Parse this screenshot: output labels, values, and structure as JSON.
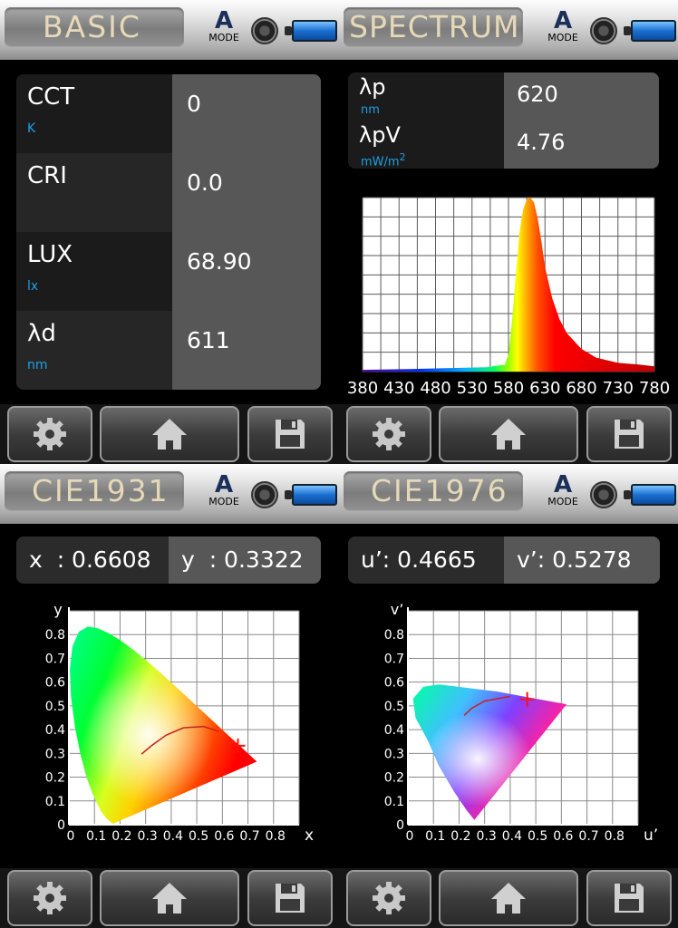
{
  "header": {
    "mode_letter": "A",
    "mode_label": "MODE"
  },
  "footer": {
    "settings_icon": "gear-icon",
    "home_icon": "home-icon",
    "save_icon": "floppy-disk-icon"
  },
  "panels": {
    "basic": {
      "title": "BASIC",
      "rows": [
        {
          "name": "CCT",
          "unit": "K",
          "value": "0"
        },
        {
          "name": "CRI",
          "unit": "",
          "value": "0.0"
        },
        {
          "name": "LUX",
          "unit": "lx",
          "value": "68.90"
        },
        {
          "name": "λd",
          "unit": "nm",
          "value": "611"
        }
      ]
    },
    "spectrum": {
      "title": "SPECTRUM",
      "rows": [
        {
          "name": "λp",
          "unit": "nm",
          "value": "620"
        },
        {
          "name": "λpV",
          "unit": "mW/m",
          "unit_sup": "2",
          "value": "4.76"
        }
      ],
      "chart_data": {
        "type": "area",
        "x": [
          380,
          450,
          500,
          550,
          575,
          580,
          585,
          590,
          595,
          600,
          605,
          610,
          615,
          620,
          625,
          630,
          640,
          650,
          660,
          680,
          700,
          730,
          760,
          780
        ],
        "y": [
          0.01,
          0.015,
          0.02,
          0.025,
          0.04,
          0.1,
          0.3,
          0.55,
          0.8,
          0.93,
          0.99,
          1.0,
          0.97,
          0.88,
          0.75,
          0.6,
          0.42,
          0.3,
          0.22,
          0.13,
          0.08,
          0.05,
          0.04,
          0.03
        ],
        "xlim": [
          380,
          780
        ],
        "ylim": [
          0,
          1
        ],
        "xticks": [
          "380",
          "430",
          "480",
          "530",
          "580",
          "630",
          "680",
          "730",
          "780"
        ],
        "grid": true
      }
    },
    "cie1931": {
      "title": "CIE1931",
      "left": "x  : 0.6608",
      "right": "y  : 0.3322",
      "chart_data": {
        "type": "scatter",
        "xlabel": "x",
        "ylabel": "y",
        "xlim": [
          0,
          0.9
        ],
        "ylim": [
          0,
          0.9
        ],
        "xticks": [
          "0",
          "0.1",
          "0.2",
          "0.3",
          "0.4",
          "0.5",
          "0.6",
          "0.7",
          "0.8"
        ],
        "yticks": [
          "0",
          "0.1",
          "0.2",
          "0.3",
          "0.4",
          "0.5",
          "0.6",
          "0.7",
          "0.8"
        ],
        "point": {
          "x": 0.6608,
          "y": 0.3322
        },
        "gamut_x": [
          0.1741,
          0.1738,
          0.173,
          0.1689,
          0.1644,
          0.1566,
          0.144,
          0.1241,
          0.0913,
          0.0687,
          0.0454,
          0.0235,
          0.0082,
          0.0039,
          0.0139,
          0.0389,
          0.0743,
          0.1142,
          0.1547,
          0.1929,
          0.2296,
          0.2658,
          0.3016,
          0.3373,
          0.3731,
          0.4087,
          0.4441,
          0.4788,
          0.5125,
          0.5448,
          0.5752,
          0.6029,
          0.627,
          0.6482,
          0.6658,
          0.6801,
          0.6915,
          0.7006,
          0.7079,
          0.7135,
          0.7347
        ],
        "gamut_y": [
          0.005,
          0.0049,
          0.0048,
          0.0069,
          0.0109,
          0.0177,
          0.0297,
          0.0578,
          0.1327,
          0.2007,
          0.295,
          0.4127,
          0.5384,
          0.6548,
          0.7502,
          0.812,
          0.8338,
          0.8262,
          0.8059,
          0.7816,
          0.7543,
          0.7243,
          0.6923,
          0.6589,
          0.6245,
          0.5896,
          0.5547,
          0.5202,
          0.4866,
          0.4544,
          0.4242,
          0.3965,
          0.3725,
          0.3514,
          0.334,
          0.3197,
          0.3083,
          0.2993,
          0.292,
          0.2864,
          0.2653
        ],
        "locus_x": [
          0.5857,
          0.5267,
          0.4476,
          0.3805,
          0.3221,
          0.2839
        ],
        "locus_y": [
          0.3931,
          0.4133,
          0.4074,
          0.3768,
          0.3318,
          0.297
        ]
      }
    },
    "cie1976": {
      "title": "CIE1976",
      "left": "u’: 0.4665",
      "right": "v’: 0.5278",
      "chart_data": {
        "type": "scatter",
        "xlabel": "u’",
        "ylabel": "v’",
        "xlim": [
          0,
          0.9
        ],
        "ylim": [
          0,
          0.9
        ],
        "xticks": [
          "0",
          "0.1",
          "0.2",
          "0.3",
          "0.4",
          "0.5",
          "0.6",
          "0.7",
          "0.8"
        ],
        "yticks": [
          "0",
          "0.1",
          "0.2",
          "0.3",
          "0.4",
          "0.5",
          "0.6",
          "0.7",
          "0.8"
        ],
        "point": {
          "x": 0.4665,
          "y": 0.5278
        },
        "gamut_x": [
          0.6234,
          0.5,
          0.35,
          0.2,
          0.12,
          0.06,
          0.02,
          0.03,
          0.08,
          0.12,
          0.18,
          0.23,
          0.26,
          0.62
        ],
        "gamut_y": [
          0.5063,
          0.53,
          0.56,
          0.58,
          0.59,
          0.58,
          0.53,
          0.45,
          0.35,
          0.25,
          0.14,
          0.06,
          0.02,
          0.5063
        ],
        "locus_x": [
          0.4,
          0.3,
          0.25,
          0.22
        ],
        "locus_y": [
          0.54,
          0.52,
          0.49,
          0.46
        ]
      }
    }
  }
}
